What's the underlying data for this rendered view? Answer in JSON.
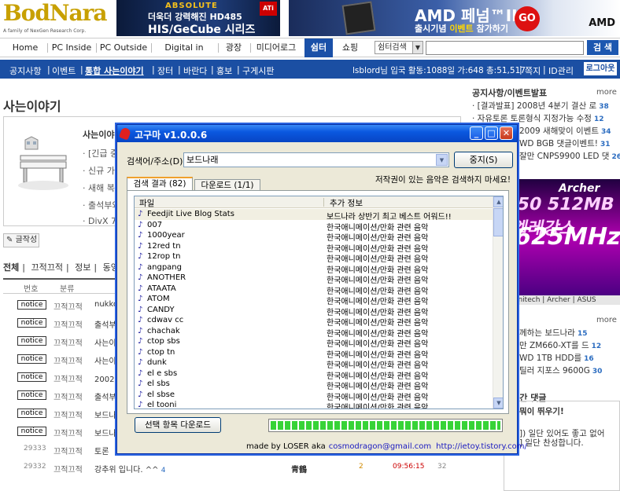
{
  "header": {
    "logo_text": "BodNara",
    "logo_sub": "A family of NexGen Research Corp.",
    "banner1": {
      "brand": "ABSOLUTE",
      "line1": "더욱더 강력해진 HD485",
      "line2": "HIS/GeCube 시리즈",
      "badge": "ATi"
    },
    "banner2": {
      "title": "AMD 페넘™II",
      "sub_pre": "출시기념 ",
      "sub_hl": "이벤트",
      "sub_post": " 참가하기",
      "go": "GO",
      "brand": "AMD"
    }
  },
  "nav": {
    "tabs": [
      "Home",
      "PC Inside",
      "PC Outside",
      "Digital in Hand",
      "광장",
      "미디어로그",
      "쉼터",
      "쇼핑"
    ],
    "selected": "쉼터",
    "search_select": "쉼터검색",
    "search_button": "검 색"
  },
  "subnav": {
    "items": [
      "공지사항",
      "이벤트",
      "통합 사는이야기",
      "장터",
      "바란다",
      "홍보",
      "구게시판"
    ],
    "selected": "통합 사는이야기",
    "status": "lsblord님 입국 활동:1088일 가:648 총:51,517",
    "links": [
      "쪽지",
      "ID관리"
    ],
    "logout": "로그아웃"
  },
  "left": {
    "page_title": "사는이야기",
    "intro": {
      "head": "사는이야기",
      "lines": [
        "· [긴급 중요",
        "· 신규 가입",
        "· 새해 복 만",
        "· 출석부와",
        "· DivX 7 /"
      ]
    },
    "write_button": "글작성",
    "cat_tabs": [
      "전체",
      "끄적끄적",
      "정보",
      "동영상"
    ],
    "table_head": {
      "num": "번호",
      "cat": "분류"
    },
    "rows": [
      {
        "badge": "notice",
        "cat": "끄적끄적",
        "title": "nukko"
      },
      {
        "badge": "notice",
        "cat": "끄적끄적",
        "title": "출석부"
      },
      {
        "badge": "notice",
        "cat": "끄적끄적",
        "title": "사는이"
      },
      {
        "badge": "notice",
        "cat": "끄적끄적",
        "title": "사는이"
      },
      {
        "badge": "notice",
        "cat": "끄적끄적",
        "title": "2002년"
      },
      {
        "badge": "notice",
        "cat": "끄적끄적",
        "title": "출석부"
      },
      {
        "badge": "notice",
        "cat": "끄적끄적",
        "title": "보드나"
      },
      {
        "badge": "notice",
        "cat": "끄적끄적",
        "title": "보드나"
      },
      {
        "num": "29333",
        "cat": "끄적끄적",
        "title": "토론"
      },
      {
        "num": "29332",
        "cat": "끄적끄적",
        "title": "강추위 입니다. ^^",
        "comments": "4",
        "author": "青鶴",
        "votes": "2",
        "time": "09:56:15",
        "views": "32"
      }
    ]
  },
  "right": {
    "notice_head": "공지사항/이벤트발표",
    "more": "more",
    "notices": [
      {
        "text": "· [결과발표] 2008년 4분기 결산 로",
        "count": "38"
      },
      {
        "text": "· 자유토론 토론형식 지정가능 수정",
        "count": "12"
      },
      {
        "text": "2009 새해맞이 이벤트",
        "count": "34"
      },
      {
        "text": "WD BGB 댓글이벤트!",
        "count": "31"
      },
      {
        "text": "잘만 CNPS9900 LED 댓",
        "count": "26"
      }
    ],
    "banner": {
      "brand": "Archer",
      "l1": "50 512MB 엘레강스",
      "l2": "625MHz"
    },
    "brands_bar": "| Unitech | Archer | ASUS",
    "more2": "more",
    "list2": [
      {
        "text": "께하는 보드나라",
        "count": "15"
      },
      {
        "text": "만 ZM660-XT를 드",
        "count": "12"
      },
      {
        "text": "WD 1TB HDD를",
        "count": "16"
      },
      {
        "text": "틸러 지포스 9600G",
        "count": "30"
      }
    ],
    "sec2_head": "실시간 댓글",
    "sec2_lines": [
      "뭐이 뛰우기!",
      "]) 일단 있어도 좋고 없어",
      "] 일단 찬성합니다."
    ]
  },
  "dialog": {
    "title": "고구마 v1.0.0.6",
    "search_label": "검색어/주소(D):",
    "search_value": "보드나래",
    "stop_button": "중지(S)",
    "warning": "저작권이 있는 음악은 검색하지 마세요!",
    "tabs": [
      "검색 결과 (82)",
      "다운로드 (1/1)"
    ],
    "columns": [
      "파일",
      "추가 정보"
    ],
    "rows": [
      {
        "file": "Feedjit Live Blog Stats",
        "info": "보드나라 상반기 최고 베스트 어워드!!"
      },
      {
        "file": "007",
        "info": "한국애니메이션/만화 관련 음악"
      },
      {
        "file": "1000year",
        "info": "한국애니메이션/만화 관련 음악"
      },
      {
        "file": "12red tn",
        "info": "한국애니메이션/만화 관련 음악"
      },
      {
        "file": "12rop tn",
        "info": "한국애니메이션/만화 관련 음악"
      },
      {
        "file": "angpang",
        "info": "한국애니메이션/만화 관련 음악"
      },
      {
        "file": "ANOTHER",
        "info": "한국애니메이션/만화 관련 음악"
      },
      {
        "file": "ATAATA",
        "info": "한국애니메이션/만화 관련 음악"
      },
      {
        "file": "ATOM",
        "info": "한국애니메이션/만화 관련 음악"
      },
      {
        "file": "CANDY",
        "info": "한국애니메이션/만화 관련 음악"
      },
      {
        "file": "cdwav cc",
        "info": "한국애니메이션/만화 관련 음악"
      },
      {
        "file": "chachak",
        "info": "한국애니메이션/만화 관련 음악"
      },
      {
        "file": "ctop sbs",
        "info": "한국애니메이션/만화 관련 음악"
      },
      {
        "file": "ctop tn",
        "info": "한국애니메이션/만화 관련 음악"
      },
      {
        "file": "dunk",
        "info": "한국애니메이션/만화 관련 음악"
      },
      {
        "file": "el e sbs",
        "info": "한국애니메이션/만화 관련 음악"
      },
      {
        "file": "el sbs",
        "info": "한국애니메이션/만화 관련 음악"
      },
      {
        "file": "el sbse",
        "info": "한국애니메이션/만화 관련 음악"
      },
      {
        "file": "el tooni",
        "info": "한국애니메이션/만화 관련 음악"
      }
    ],
    "download_button": "선택 항목 다운로드",
    "progress_fraction": 1.0,
    "credit_pre": "made by LOSER aka",
    "credit_email": "cosmodragon@gmail.com",
    "credit_url": "http://ietoy.tistory.com/"
  }
}
